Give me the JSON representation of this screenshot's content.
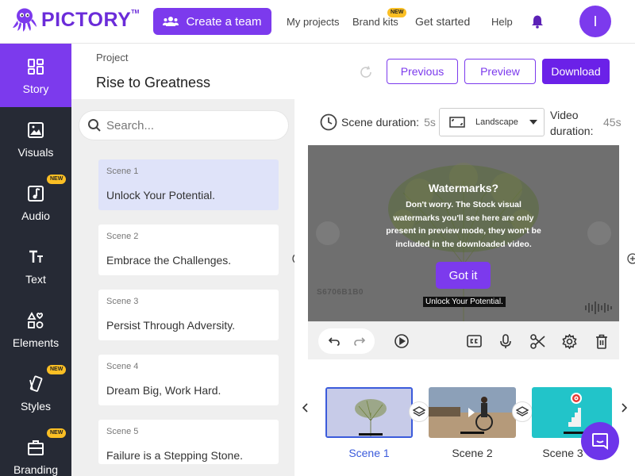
{
  "app": {
    "logo_text": "PICTORY",
    "logo_tm": "TM",
    "brand_color": "#7c3aed"
  },
  "header": {
    "create_team_label": "Create a team",
    "nav": [
      {
        "label": "My projects"
      },
      {
        "label": "Brand kits",
        "badge": "NEW"
      },
      {
        "label": "Get started"
      },
      {
        "label": "Help"
      }
    ],
    "bell_icon": "bell-icon",
    "avatar_initial": "I"
  },
  "sidebar": {
    "items": [
      {
        "label": "Story",
        "icon": "story-icon",
        "active": true
      },
      {
        "label": "Visuals",
        "icon": "image-icon"
      },
      {
        "label": "Audio",
        "icon": "music-icon",
        "badge": "NEW"
      },
      {
        "label": "Text",
        "icon": "text-icon"
      },
      {
        "label": "Elements",
        "icon": "shapes-icon"
      },
      {
        "label": "Styles",
        "icon": "styles-icon",
        "badge": "NEW"
      },
      {
        "label": "Branding",
        "icon": "briefcase-icon",
        "badge": "NEW"
      }
    ]
  },
  "project": {
    "label": "Project",
    "title": "Rise to Greatness",
    "previous_label": "Previous",
    "preview_label": "Preview",
    "download_label": "Download"
  },
  "search": {
    "placeholder": "Search..."
  },
  "scenes": [
    {
      "num": "Scene 1",
      "text": "Unlock Your Potential.",
      "active": true
    },
    {
      "num": "Scene 2",
      "text": "Embrace the Challenges."
    },
    {
      "num": "Scene 3",
      "text": "Persist Through Adversity."
    },
    {
      "num": "Scene 4",
      "text": "Dream Big, Work Hard."
    },
    {
      "num": "Scene 5",
      "text": "Failure is a Stepping Stone."
    }
  ],
  "toolbar": {
    "scene_duration_label": "Scene duration:",
    "scene_duration_value": "5s",
    "layout_value": "Landscape",
    "video_duration_label": "Video duration:",
    "video_duration_value": "45s"
  },
  "preview": {
    "watermark_title": "Watermarks?",
    "watermark_body": "Don't worry. The Stock visual watermarks you'll see here are only present in preview mode, they won't be included in the downloaded video.",
    "got_it_label": "Got it",
    "caption": "Unlock Your Potential.",
    "stock_id": "S6706B1B0"
  },
  "timeline": {
    "thumbs": [
      {
        "label": "Scene 1",
        "selected": true
      },
      {
        "label": "Scene 2"
      },
      {
        "label": "Scene 3"
      }
    ]
  }
}
